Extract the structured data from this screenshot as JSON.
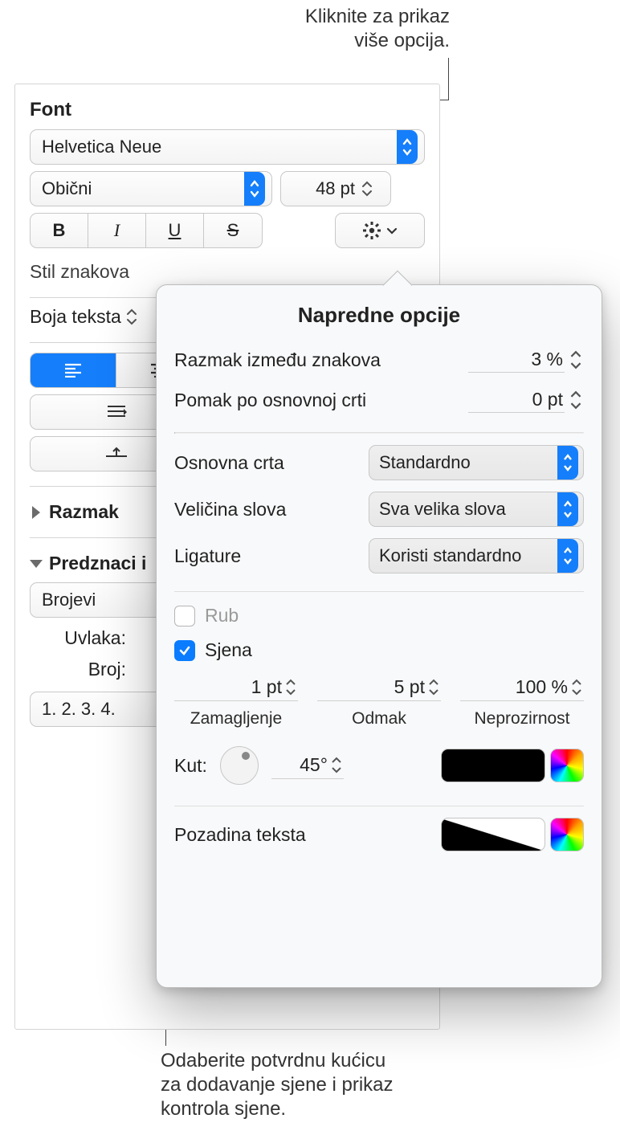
{
  "annotations": {
    "top": "Kliknite za prikaz\nviše opcija.",
    "bottom": "Odaberite potvrdnu kućicu\nza dodavanje sjene i prikaz\nkontrola sjene."
  },
  "font": {
    "title": "Font",
    "family": "Helvetica Neue",
    "typeface": "Obični",
    "size": "48 pt"
  },
  "styleButtons": {
    "bold": "B",
    "italic": "I",
    "underline": "U",
    "strike": "S"
  },
  "charStyle": {
    "label": "Stil znakova"
  },
  "textColor": {
    "label": "Boja teksta"
  },
  "disclosure": {
    "spacing": "Razmak",
    "bullets": "Predznaci i"
  },
  "bullets": {
    "type": "Brojevi",
    "indentLabel": "Uvlaka:",
    "numberLabel": "Broj:",
    "format": "1. 2. 3. 4."
  },
  "advanced": {
    "title": "Napredne opcije",
    "tracking": {
      "label": "Razmak između znakova",
      "value": "3 %"
    },
    "baselineShift": {
      "label": "Pomak po osnovnoj crti",
      "value": "0 pt"
    },
    "baseline": {
      "label": "Osnovna crta",
      "value": "Standardno"
    },
    "caps": {
      "label": "Veličina slova",
      "value": "Sva velika slova"
    },
    "ligatures": {
      "label": "Ligature",
      "value": "Koristi standardno"
    },
    "outline": {
      "label": "Rub",
      "checked": false
    },
    "shadow": {
      "label": "Sjena",
      "checked": true,
      "blur": {
        "value": "1 pt",
        "caption": "Zamagljenje"
      },
      "offset": {
        "value": "5 pt",
        "caption": "Odmak"
      },
      "opacity": {
        "value": "100 %",
        "caption": "Neprozirnost"
      },
      "angleLabel": "Kut:",
      "angleValue": "45°",
      "color": "#000000"
    },
    "textBackground": {
      "label": "Pozadina teksta"
    }
  }
}
